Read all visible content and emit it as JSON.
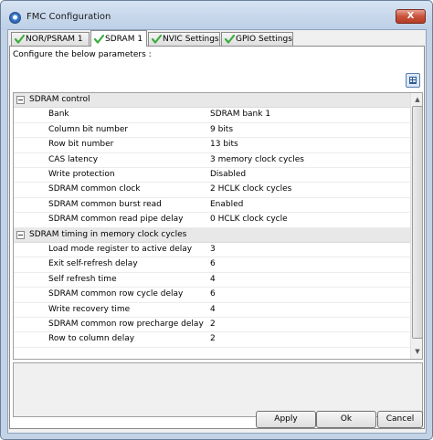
{
  "window": {
    "title": "FMC Configuration",
    "close_label": "X"
  },
  "tabs": [
    {
      "label": "NOR/PSRAM 1",
      "active": false
    },
    {
      "label": "SDRAM 1",
      "active": true
    },
    {
      "label": "NVIC Settings",
      "active": false
    },
    {
      "label": "GPIO Settings",
      "active": false
    }
  ],
  "panel": {
    "instructions": "Configure the below parameters :"
  },
  "groups": [
    {
      "label": "SDRAM control",
      "params": [
        {
          "name": "Bank",
          "value": "SDRAM bank 1"
        },
        {
          "name": "Column bit number",
          "value": "9 bits"
        },
        {
          "name": "Row bit number",
          "value": "13 bits"
        },
        {
          "name": "CAS latency",
          "value": "3 memory clock cycles"
        },
        {
          "name": "Write protection",
          "value": "Disabled"
        },
        {
          "name": "SDRAM common clock",
          "value": "2 HCLK clock cycles"
        },
        {
          "name": "SDRAM common burst read",
          "value": "Enabled"
        },
        {
          "name": "SDRAM common read pipe delay",
          "value": "0 HCLK clock cycle"
        }
      ]
    },
    {
      "label": "SDRAM timing in memory clock cycles",
      "params": [
        {
          "name": "Load mode register to active delay",
          "value": "3"
        },
        {
          "name": "Exit self-refresh delay",
          "value": "6"
        },
        {
          "name": "Self refresh time",
          "value": "4"
        },
        {
          "name": "SDRAM common row cycle delay",
          "value": "6"
        },
        {
          "name": "Write recovery time",
          "value": "4"
        },
        {
          "name": "SDRAM common row precharge delay",
          "value": "2"
        },
        {
          "name": "Row to column delay",
          "value": "2"
        }
      ]
    }
  ],
  "buttons": {
    "apply": "Apply",
    "ok": "Ok",
    "cancel": "Cancel"
  },
  "colors": {
    "check_green": "#3cae3c",
    "titlebar": "#c3d3e6",
    "group_row": "#e8e8e8"
  },
  "icons": {
    "app": "shield-icon",
    "tab_status": "checkmark-icon",
    "view_toggle": "grid-view-icon"
  }
}
